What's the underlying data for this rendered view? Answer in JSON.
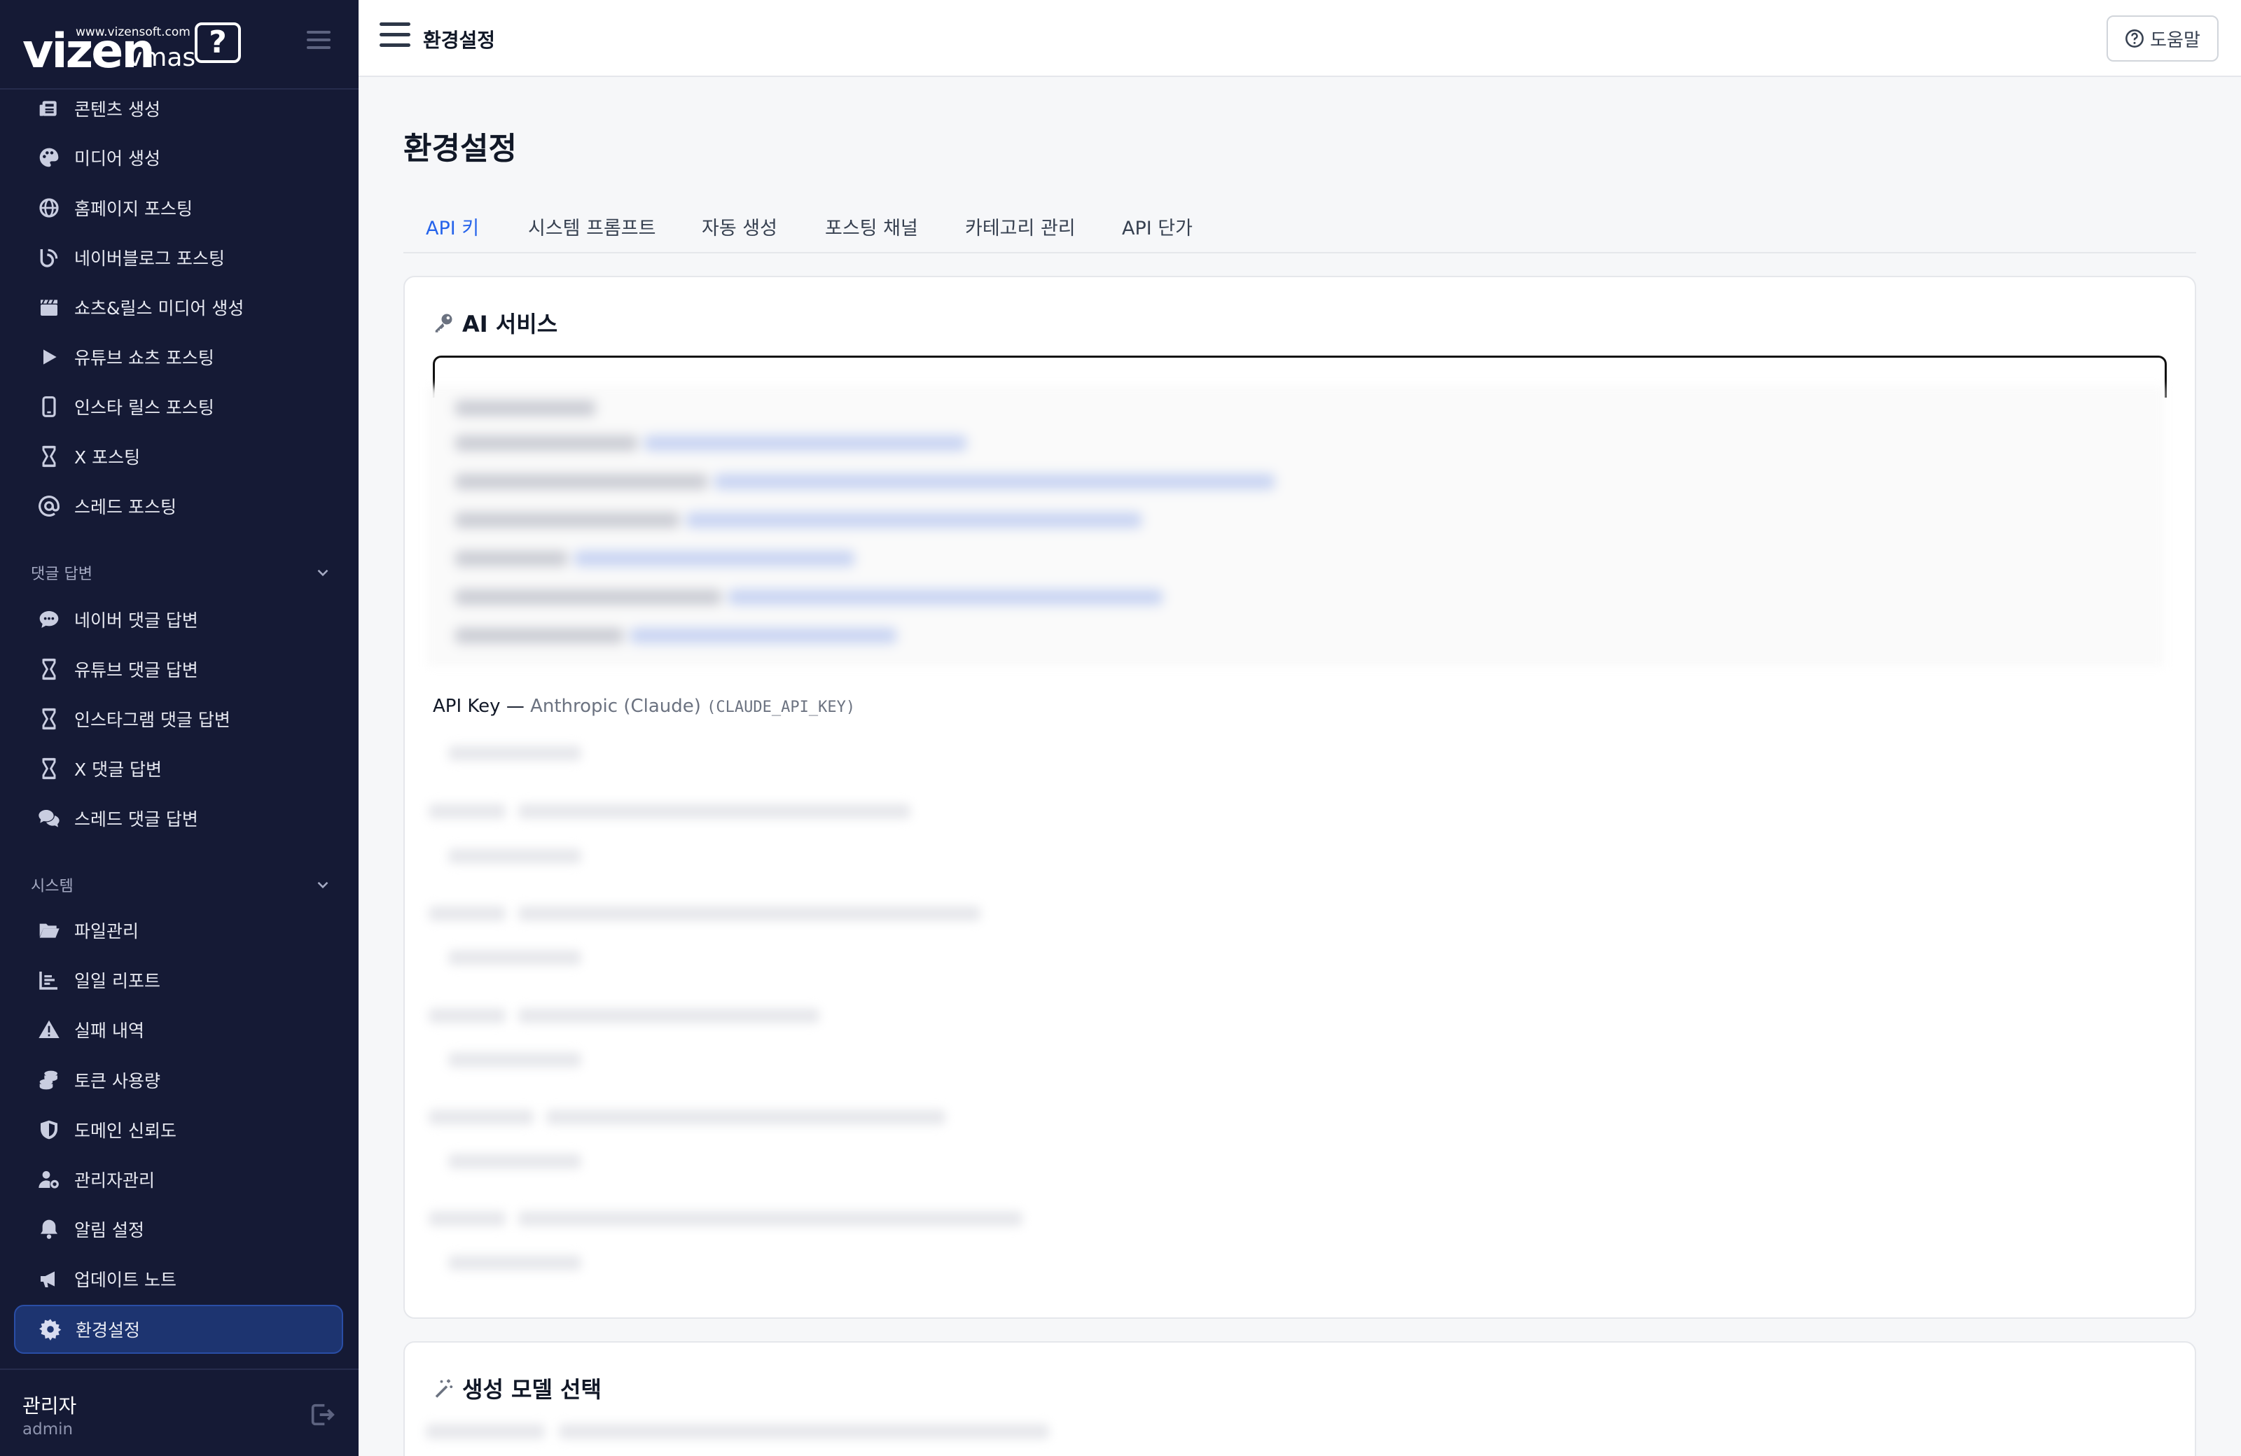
{
  "brand": {
    "name": "vizen",
    "product": "vmas",
    "url": "www.vizensoft.com",
    "bubble": "?"
  },
  "sidebar": {
    "top_items": [
      {
        "label": "콘텐츠 생성",
        "icon": "newspaper-icon"
      },
      {
        "label": "미디어 생성",
        "icon": "palette-icon"
      },
      {
        "label": "홈페이지 포스팅",
        "icon": "globe-icon"
      },
      {
        "label": "네이버블로그 포스팅",
        "icon": "blog-icon"
      },
      {
        "label": "쇼츠&릴스 미디어 생성",
        "icon": "clapperboard-icon"
      },
      {
        "label": "유튜브 쇼츠 포스팅",
        "icon": "play-icon"
      },
      {
        "label": "인스타 릴스 포스팅",
        "icon": "mobile-icon"
      },
      {
        "label": "X 포스팅",
        "icon": "x-icon"
      },
      {
        "label": "스레드 포스팅",
        "icon": "at-icon"
      }
    ],
    "sections": [
      {
        "title": "댓글 답변",
        "items": [
          {
            "label": "네이버 댓글 답변",
            "icon": "comment-dots-icon"
          },
          {
            "label": "유튜브 댓글 답변",
            "icon": "hourglass-icon"
          },
          {
            "label": "인스타그램 댓글 답변",
            "icon": "hourglass-icon"
          },
          {
            "label": "X 댓글 답변",
            "icon": "hourglass-icon"
          },
          {
            "label": "스레드 댓글 답변",
            "icon": "comments-icon"
          }
        ]
      },
      {
        "title": "시스템",
        "items": [
          {
            "label": "파일관리",
            "icon": "folder-open-icon"
          },
          {
            "label": "일일 리포트",
            "icon": "chart-icon"
          },
          {
            "label": "실패 내역",
            "icon": "warning-icon"
          },
          {
            "label": "토큰 사용량",
            "icon": "coins-icon"
          },
          {
            "label": "도메인 신뢰도",
            "icon": "shield-icon"
          },
          {
            "label": "관리자관리",
            "icon": "user-gear-icon"
          },
          {
            "label": "알림 설정",
            "icon": "bell-icon"
          },
          {
            "label": "업데이트 노트",
            "icon": "bullhorn-icon"
          },
          {
            "label": "환경설정",
            "icon": "gear-icon",
            "active": true
          }
        ]
      }
    ]
  },
  "user": {
    "name": "관리자",
    "id": "admin"
  },
  "topbar": {
    "title": "환경설정",
    "help_label": "도움말"
  },
  "main": {
    "page_title": "환경설정",
    "tabs": [
      "API 키",
      "시스템 프롬프트",
      "자동 생성",
      "포스팅 채널",
      "카테고리 관리",
      "API 단가"
    ],
    "active_tab": "API 키",
    "ai_card": {
      "title": "AI 서비스",
      "key_label": "API Key",
      "provider": "Anthropic (Claude)",
      "env_var": "(CLAUDE_API_KEY)"
    },
    "model_card": {
      "title": "생성 모델 선택"
    }
  },
  "colors": {
    "sidebar_bg": "#151a35",
    "active_bg": "#1d3470",
    "accent": "#2563eb"
  }
}
